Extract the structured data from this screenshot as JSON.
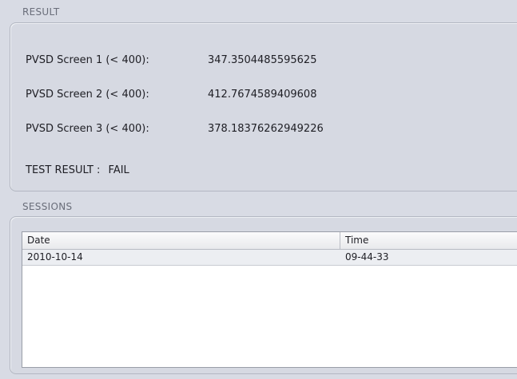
{
  "result": {
    "header": "RESULT",
    "rows": [
      {
        "label": "PVSD Screen 1 (< 400):",
        "value": "347.3504485595625"
      },
      {
        "label": "PVSD Screen 2 (< 400):",
        "value": "412.7674589409608"
      },
      {
        "label": "PVSD Screen 3 (< 400):",
        "value": "378.18376262949226"
      }
    ],
    "test_result_label": "TEST RESULT :",
    "test_result_value": "FAIL"
  },
  "sessions": {
    "header": "SESSIONS",
    "columns": [
      "Date",
      "Time"
    ],
    "rows": [
      {
        "date": "2010-10-14",
        "time": "09-44-33"
      }
    ]
  }
}
